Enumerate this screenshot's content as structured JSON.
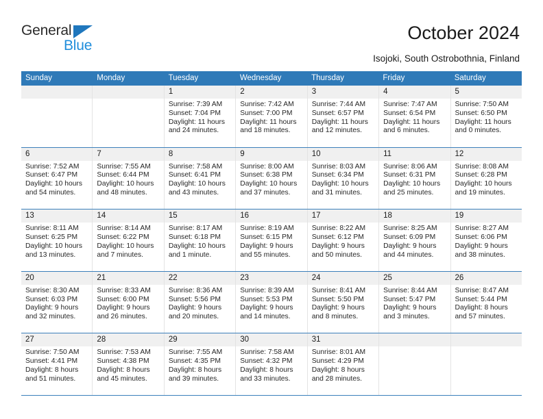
{
  "brand": {
    "name_part1": "General",
    "name_part2": "Blue",
    "triangle_icon": "triangle-icon",
    "colors": {
      "dark": "#2b2b2b",
      "blue": "#1f8ddb",
      "triangle": "#1f77bd"
    }
  },
  "header": {
    "title": "October 2024",
    "subtitle": "Isojoki, South Ostrobothnia, Finland"
  },
  "theme": {
    "header_row_bg": "#2f7ab8",
    "header_row_text": "#ffffff",
    "daynum_band_bg": "#f0f0f0",
    "week_divider": "#3a7fba",
    "cell_divider": "#e3e3e3"
  },
  "calendar": {
    "weekday_headers": [
      "Sunday",
      "Monday",
      "Tuesday",
      "Wednesday",
      "Thursday",
      "Friday",
      "Saturday"
    ],
    "weeks": [
      [
        {
          "day": "",
          "lines": []
        },
        {
          "day": "",
          "lines": []
        },
        {
          "day": "1",
          "lines": [
            "Sunrise: 7:39 AM",
            "Sunset: 7:04 PM",
            "Daylight: 11 hours",
            "and 24 minutes."
          ]
        },
        {
          "day": "2",
          "lines": [
            "Sunrise: 7:42 AM",
            "Sunset: 7:00 PM",
            "Daylight: 11 hours",
            "and 18 minutes."
          ]
        },
        {
          "day": "3",
          "lines": [
            "Sunrise: 7:44 AM",
            "Sunset: 6:57 PM",
            "Daylight: 11 hours",
            "and 12 minutes."
          ]
        },
        {
          "day": "4",
          "lines": [
            "Sunrise: 7:47 AM",
            "Sunset: 6:54 PM",
            "Daylight: 11 hours",
            "and 6 minutes."
          ]
        },
        {
          "day": "5",
          "lines": [
            "Sunrise: 7:50 AM",
            "Sunset: 6:50 PM",
            "Daylight: 11 hours",
            "and 0 minutes."
          ]
        }
      ],
      [
        {
          "day": "6",
          "lines": [
            "Sunrise: 7:52 AM",
            "Sunset: 6:47 PM",
            "Daylight: 10 hours",
            "and 54 minutes."
          ]
        },
        {
          "day": "7",
          "lines": [
            "Sunrise: 7:55 AM",
            "Sunset: 6:44 PM",
            "Daylight: 10 hours",
            "and 48 minutes."
          ]
        },
        {
          "day": "8",
          "lines": [
            "Sunrise: 7:58 AM",
            "Sunset: 6:41 PM",
            "Daylight: 10 hours",
            "and 43 minutes."
          ]
        },
        {
          "day": "9",
          "lines": [
            "Sunrise: 8:00 AM",
            "Sunset: 6:38 PM",
            "Daylight: 10 hours",
            "and 37 minutes."
          ]
        },
        {
          "day": "10",
          "lines": [
            "Sunrise: 8:03 AM",
            "Sunset: 6:34 PM",
            "Daylight: 10 hours",
            "and 31 minutes."
          ]
        },
        {
          "day": "11",
          "lines": [
            "Sunrise: 8:06 AM",
            "Sunset: 6:31 PM",
            "Daylight: 10 hours",
            "and 25 minutes."
          ]
        },
        {
          "day": "12",
          "lines": [
            "Sunrise: 8:08 AM",
            "Sunset: 6:28 PM",
            "Daylight: 10 hours",
            "and 19 minutes."
          ]
        }
      ],
      [
        {
          "day": "13",
          "lines": [
            "Sunrise: 8:11 AM",
            "Sunset: 6:25 PM",
            "Daylight: 10 hours",
            "and 13 minutes."
          ]
        },
        {
          "day": "14",
          "lines": [
            "Sunrise: 8:14 AM",
            "Sunset: 6:22 PM",
            "Daylight: 10 hours",
            "and 7 minutes."
          ]
        },
        {
          "day": "15",
          "lines": [
            "Sunrise: 8:17 AM",
            "Sunset: 6:18 PM",
            "Daylight: 10 hours",
            "and 1 minute."
          ]
        },
        {
          "day": "16",
          "lines": [
            "Sunrise: 8:19 AM",
            "Sunset: 6:15 PM",
            "Daylight: 9 hours",
            "and 55 minutes."
          ]
        },
        {
          "day": "17",
          "lines": [
            "Sunrise: 8:22 AM",
            "Sunset: 6:12 PM",
            "Daylight: 9 hours",
            "and 50 minutes."
          ]
        },
        {
          "day": "18",
          "lines": [
            "Sunrise: 8:25 AM",
            "Sunset: 6:09 PM",
            "Daylight: 9 hours",
            "and 44 minutes."
          ]
        },
        {
          "day": "19",
          "lines": [
            "Sunrise: 8:27 AM",
            "Sunset: 6:06 PM",
            "Daylight: 9 hours",
            "and 38 minutes."
          ]
        }
      ],
      [
        {
          "day": "20",
          "lines": [
            "Sunrise: 8:30 AM",
            "Sunset: 6:03 PM",
            "Daylight: 9 hours",
            "and 32 minutes."
          ]
        },
        {
          "day": "21",
          "lines": [
            "Sunrise: 8:33 AM",
            "Sunset: 6:00 PM",
            "Daylight: 9 hours",
            "and 26 minutes."
          ]
        },
        {
          "day": "22",
          "lines": [
            "Sunrise: 8:36 AM",
            "Sunset: 5:56 PM",
            "Daylight: 9 hours",
            "and 20 minutes."
          ]
        },
        {
          "day": "23",
          "lines": [
            "Sunrise: 8:39 AM",
            "Sunset: 5:53 PM",
            "Daylight: 9 hours",
            "and 14 minutes."
          ]
        },
        {
          "day": "24",
          "lines": [
            "Sunrise: 8:41 AM",
            "Sunset: 5:50 PM",
            "Daylight: 9 hours",
            "and 8 minutes."
          ]
        },
        {
          "day": "25",
          "lines": [
            "Sunrise: 8:44 AM",
            "Sunset: 5:47 PM",
            "Daylight: 9 hours",
            "and 3 minutes."
          ]
        },
        {
          "day": "26",
          "lines": [
            "Sunrise: 8:47 AM",
            "Sunset: 5:44 PM",
            "Daylight: 8 hours",
            "and 57 minutes."
          ]
        }
      ],
      [
        {
          "day": "27",
          "lines": [
            "Sunrise: 7:50 AM",
            "Sunset: 4:41 PM",
            "Daylight: 8 hours",
            "and 51 minutes."
          ]
        },
        {
          "day": "28",
          "lines": [
            "Sunrise: 7:53 AM",
            "Sunset: 4:38 PM",
            "Daylight: 8 hours",
            "and 45 minutes."
          ]
        },
        {
          "day": "29",
          "lines": [
            "Sunrise: 7:55 AM",
            "Sunset: 4:35 PM",
            "Daylight: 8 hours",
            "and 39 minutes."
          ]
        },
        {
          "day": "30",
          "lines": [
            "Sunrise: 7:58 AM",
            "Sunset: 4:32 PM",
            "Daylight: 8 hours",
            "and 33 minutes."
          ]
        },
        {
          "day": "31",
          "lines": [
            "Sunrise: 8:01 AM",
            "Sunset: 4:29 PM",
            "Daylight: 8 hours",
            "and 28 minutes."
          ]
        },
        {
          "day": "",
          "lines": []
        },
        {
          "day": "",
          "lines": []
        }
      ]
    ]
  }
}
